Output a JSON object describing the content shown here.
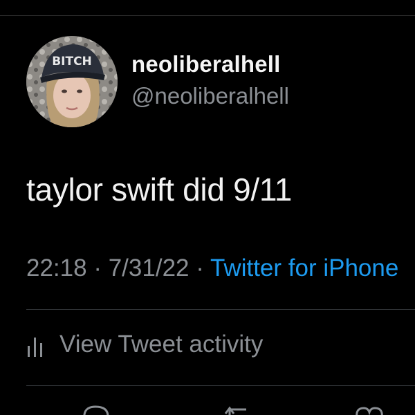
{
  "tweet": {
    "author": {
      "display_name": "neoliberalhell",
      "handle": "@neoliberalhell",
      "avatar_cap_text": "BITCH"
    },
    "text": "taylor swift did 9/11",
    "time": "22:18",
    "separator": "·",
    "date": "7/31/22",
    "source": "Twitter for iPhone"
  },
  "activity": {
    "label": "View Tweet activity"
  },
  "colors": {
    "background": "#000000",
    "primary_text": "#e7e9ea",
    "secondary_text": "#8b8f94",
    "link": "#1d9bf0",
    "divider": "#2f3336"
  },
  "icons": {
    "activity": "bar-chart-icon",
    "reply": "reply-icon",
    "retweet": "retweet-icon",
    "like": "heart-icon"
  }
}
